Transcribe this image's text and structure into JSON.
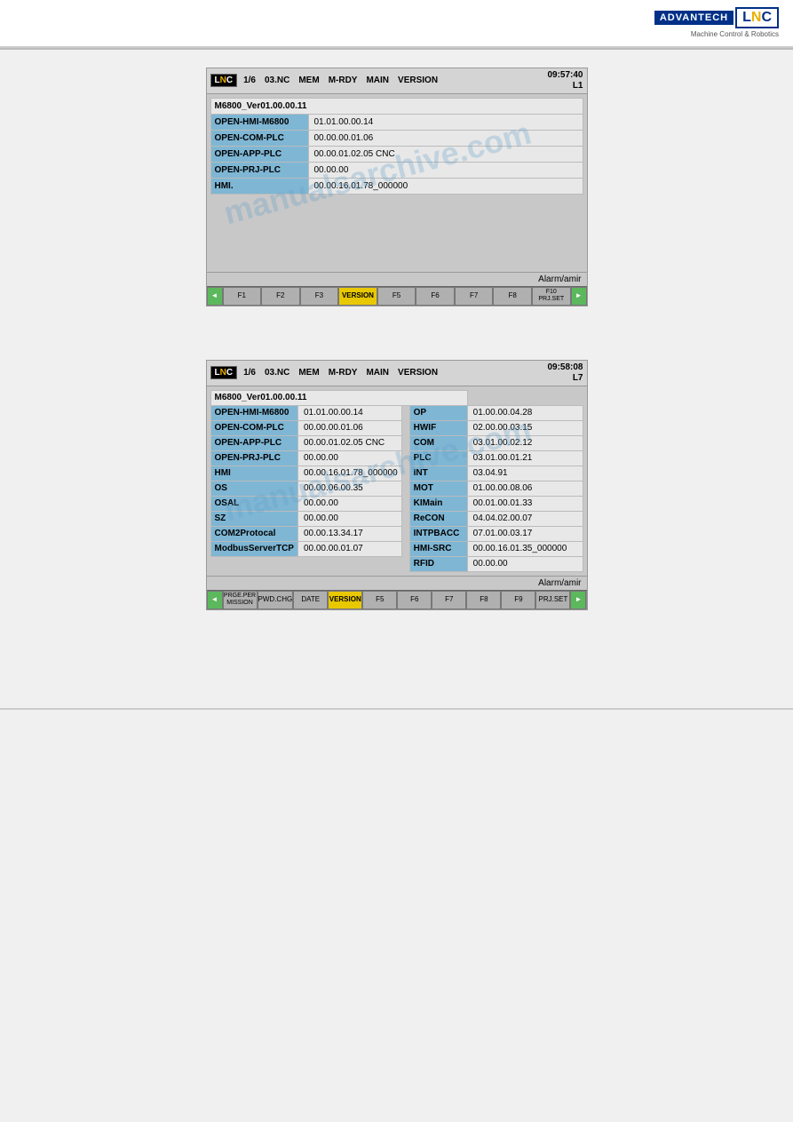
{
  "header": {
    "logo_advantech": "ADVANTECH",
    "logo_lnc": "LNC",
    "subtitle_line1": "Machine Control & Robotics"
  },
  "panel1": {
    "topbar": {
      "logo": "LNC",
      "slot": "1/6",
      "nc": "03.NC",
      "mem": "MEM",
      "mrdy": "M-RDY",
      "main": "MAIN",
      "version": "VERSION",
      "time": "09:57:40",
      "layer": "L1"
    },
    "main_version": "M6800_Ver01.00.00.11",
    "rows": [
      {
        "label": "OPEN-HMI-M6800",
        "value": "01.01.00.00.14"
      },
      {
        "label": "OPEN-COM-PLC",
        "value": "00.00.00.01.06"
      },
      {
        "label": "OPEN-APP-PLC",
        "value": "00.00.01.02.05   CNC"
      },
      {
        "label": "OPEN-PRJ-PLC",
        "value": "00.00.00"
      },
      {
        "label": "HMI.",
        "value": "00.00.16.01.78_000000"
      }
    ],
    "statusbar": "Alarm/amir",
    "fkeys": [
      {
        "label": "F1",
        "active": false
      },
      {
        "label": "F2",
        "active": false
      },
      {
        "label": "F3",
        "active": false
      },
      {
        "label": "VERSION",
        "active": true
      },
      {
        "label": "F5",
        "active": false
      },
      {
        "label": "F6",
        "active": false
      },
      {
        "label": "F7",
        "active": false
      },
      {
        "label": "F8",
        "active": false
      },
      {
        "label": "F10\nPRJ.SET",
        "active": false
      }
    ]
  },
  "panel2": {
    "topbar": {
      "logo": "LNC",
      "slot": "1/6",
      "nc": "03.NC",
      "mem": "MEM",
      "mrdy": "M-RDY",
      "main": "MAIN",
      "version": "VERSION",
      "time": "09:58:08",
      "layer": "L7"
    },
    "main_version": "M6800_Ver01.00.00.11",
    "left_rows": [
      {
        "label": "OPEN-HMI-M6800",
        "value": "01.01.00.00.14"
      },
      {
        "label": "OPEN-COM-PLC",
        "value": "00.00.00.01.06"
      },
      {
        "label": "OPEN-APP-PLC",
        "value": "00.00.01.02.05   CNC"
      },
      {
        "label": "OPEN-PRJ-PLC",
        "value": "00.00.00"
      },
      {
        "label": "HMI",
        "value": "00.00.16.01.78_000000"
      },
      {
        "label": "OS",
        "value": "00.00.06.00.35"
      },
      {
        "label": "OSAL",
        "value": "00.00.00"
      },
      {
        "label": "SZ",
        "value": "00.00.00"
      },
      {
        "label": "COM2Protocal",
        "value": "00.00.13.34.17"
      },
      {
        "label": "ModbusServerTCP",
        "value": "00.00.00.01.07"
      }
    ],
    "right_rows": [
      {
        "label": "OP",
        "value": "01.00.00.04.28"
      },
      {
        "label": "HWIF",
        "value": "02.00.00.03.15"
      },
      {
        "label": "COM",
        "value": "03.01.00.02.12"
      },
      {
        "label": "PLC",
        "value": "03.01.00.01.21"
      },
      {
        "label": "INT",
        "value": "03.04.91"
      },
      {
        "label": "MOT",
        "value": "01.00.00.08.06"
      },
      {
        "label": "KIMain",
        "value": "00.01.00.01.33"
      },
      {
        "label": "ReCON",
        "value": "04.04.02.00.07"
      },
      {
        "label": "INTPBACC",
        "value": "07.01.00.03.17"
      },
      {
        "label": "HMI-SRC",
        "value": "00.00.16.01.35_000000"
      },
      {
        "label": "RFID",
        "value": "00.00.00"
      }
    ],
    "statusbar": "Alarm/amir",
    "fkeys": [
      {
        "label": "PRGE.PER\nMISSION",
        "active": false
      },
      {
        "label": "PWD.CHG",
        "active": false
      },
      {
        "label": "DATE",
        "active": false
      },
      {
        "label": "VERSION",
        "active": true
      },
      {
        "label": "F5",
        "active": false
      },
      {
        "label": "F6",
        "active": false
      },
      {
        "label": "F7",
        "active": false
      },
      {
        "label": "F8",
        "active": false
      },
      {
        "label": "F9",
        "active": false
      },
      {
        "label": "PRJ.SET",
        "active": false
      }
    ]
  }
}
